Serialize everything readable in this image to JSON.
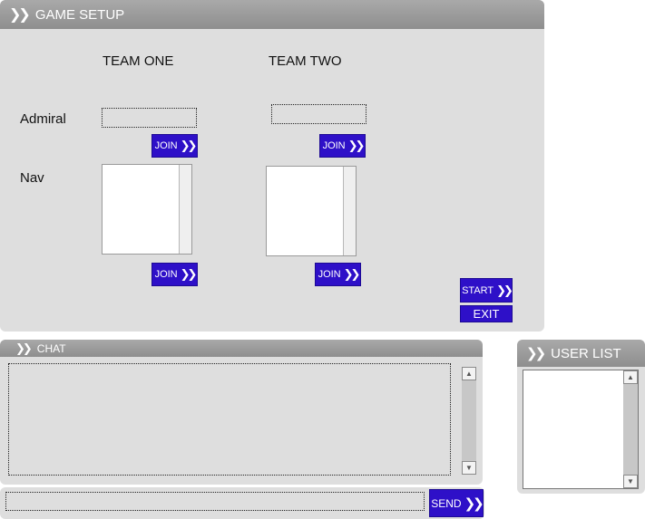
{
  "game_setup": {
    "title": "GAME SETUP",
    "team_one_label": "TEAM ONE",
    "team_two_label": "TEAM TWO",
    "admiral_label": "Admiral",
    "nav_label": "Nav",
    "join_label": "JOIN",
    "start_label": "START",
    "exit_label": "EXIT"
  },
  "chat": {
    "title": "CHAT",
    "message_input_value": "",
    "send_label": "SEND"
  },
  "user_list": {
    "title": "USER LIST"
  },
  "icons": {
    "chevron": "double-chevron-right-icon",
    "scroll_up": "scroll-up-arrow-icon",
    "scroll_down": "scroll-down-arrow-icon"
  },
  "colors": {
    "panel_bg": "#dedede",
    "header_bg": "#9c9c9c",
    "button_bg": "#2e10c8",
    "button_text": "#ffffff"
  }
}
